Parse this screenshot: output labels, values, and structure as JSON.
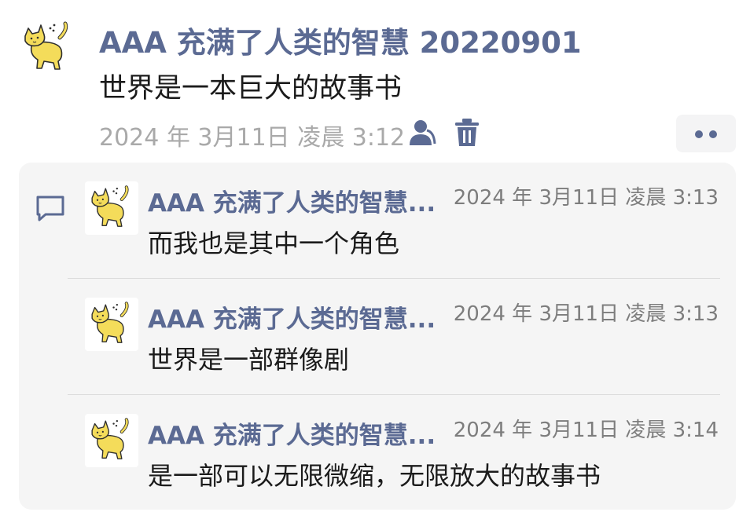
{
  "post": {
    "author": "AAA 充满了人类的智慧 20220901",
    "text": "世界是一本巨大的故事书",
    "timestamp": "2024 年 3月11日 凌晨 3:12",
    "avatar_icon": "yellow-cat-icon",
    "actions": {
      "like_icon": "person-like-icon",
      "delete_icon": "trash-icon",
      "more_icon": "more-dots-icon"
    }
  },
  "comments": {
    "icon": "comment-bubble-icon",
    "items": [
      {
        "author": "AAA 充满了人类的智慧...",
        "timestamp": "2024 年 3月11日 凌晨 3:13",
        "text": "而我也是其中一个角色"
      },
      {
        "author": "AAA 充满了人类的智慧...",
        "timestamp": "2024 年 3月11日 凌晨 3:13",
        "text": "世界是一部群像剧"
      },
      {
        "author": "AAA 充满了人类的智慧...",
        "timestamp": "2024 年 3月11日 凌晨 3:14",
        "text": "是一部可以无限微缩，无限放大的故事书"
      }
    ]
  },
  "colors": {
    "accent": "#5b6a93",
    "meta": "#a9a9a9",
    "panel": "#f5f5f5",
    "cat": "#f4dc5a"
  }
}
